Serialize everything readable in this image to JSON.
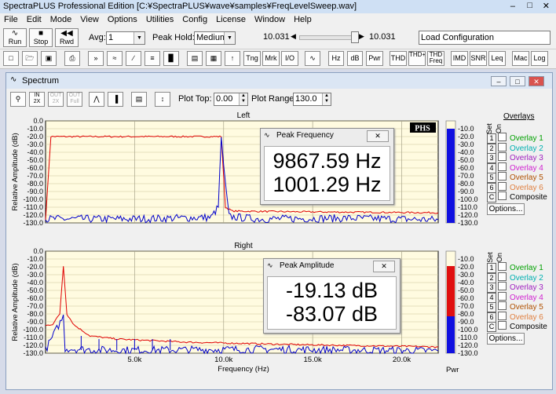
{
  "app": {
    "title": "SpectraPLUS Professional Edition [C:¥SpectraPLUS¥wave¥samples¥FreqLevelSweep.wav]"
  },
  "menu": [
    "File",
    "Edit",
    "Mode",
    "View",
    "Options",
    "Utilities",
    "Config",
    "License",
    "Window",
    "Help"
  ],
  "toolbar": {
    "run_label": "Run",
    "stop_label": "Stop",
    "rwd_label": "Rwd",
    "avg_label": "Avg:",
    "avg_value": "1",
    "peak_hold_label": "Peak Hold:",
    "peak_hold_value": "Medium",
    "slider_left_value": "10.031",
    "slider_right_value": "10.031",
    "load_config": "Load Configuration"
  },
  "toolbar2": [
    "Tng",
    "Mrk",
    "I/O",
    "Hz",
    "dB",
    "Pwr",
    "THD",
    "THD+N",
    "THD Freq",
    "IMD",
    "SNR",
    "Leq",
    "Mac",
    "Log"
  ],
  "window": {
    "title": "Spectrum",
    "plot_top_label": "Plot Top:",
    "plot_top_value": "0.00",
    "plot_range_label": "Plot Range:",
    "plot_range_value": "130.0"
  },
  "plots": {
    "left_title": "Left",
    "right_title": "Right",
    "ylabel": "Relative Amplitude (dB)",
    "xlabel": "Frequency (Hz)",
    "y_ticks": [
      "0.0",
      "-10.0",
      "-20.0",
      "-30.0",
      "-40.0",
      "-50.0",
      "-60.0",
      "-70.0",
      "-80.0",
      "-90.0",
      "-100.0",
      "-110.0",
      "-120.0",
      "-130.0"
    ],
    "x_ticks": [
      "5.0k",
      "10.0k",
      "15.0k",
      "20.0k"
    ],
    "phs_label": "PHS",
    "meter_label": "Pwr"
  },
  "popups": {
    "freq_title": "Peak Frequency",
    "freq_line1": "9867.59 Hz",
    "freq_line2": "1001.29 Hz",
    "amp_title": "Peak Amplitude",
    "amp_line1": "-19.13 dB",
    "amp_line2": "-83.07 dB"
  },
  "overlays": {
    "title": "Overlays",
    "set_label": "Set",
    "on_label": "On",
    "items": [
      {
        "num": "1",
        "label": "Overlay 1",
        "color": "#00a000"
      },
      {
        "num": "2",
        "label": "Overlay 2",
        "color": "#00b0b0"
      },
      {
        "num": "3",
        "label": "Overlay 3",
        "color": "#a020c0"
      },
      {
        "num": "4",
        "label": "Overlay 4",
        "color": "#d020d0"
      },
      {
        "num": "5",
        "label": "Overlay 5",
        "color": "#b05000"
      },
      {
        "num": "6",
        "label": "Overlay 6",
        "color": "#e08040"
      }
    ],
    "composite_num": "C",
    "composite_label": "Composite",
    "options_label": "Options..."
  },
  "chart_data": [
    {
      "type": "line",
      "title": "Left",
      "xlabel": "Frequency (Hz)",
      "ylabel": "Relative Amplitude (dB)",
      "xlim": [
        0,
        22050
      ],
      "ylim": [
        -130,
        0
      ],
      "series": [
        {
          "color": "#e00000",
          "x": [
            0,
            300,
            700,
            9300,
            9700,
            9868,
            10100,
            10500,
            15000,
            22050
          ],
          "values": [
            -126,
            -20,
            -20,
            -20,
            -20,
            -20,
            -110,
            -115,
            -116,
            -117
          ]
        },
        {
          "color": "#0000cc",
          "x": [
            0,
            5000,
            9300,
            9700,
            9868,
            10000,
            10300,
            12000,
            17000,
            22050
          ],
          "values": [
            -125,
            -125,
            -123,
            -110,
            -20,
            -60,
            -122,
            -125,
            -124,
            -126
          ]
        }
      ],
      "meter": {
        "blue_from": -130,
        "blue_to": -10
      }
    },
    {
      "type": "line",
      "title": "Right",
      "xlabel": "Frequency (Hz)",
      "ylabel": "Relative Amplitude (dB)",
      "xlim": [
        0,
        22050
      ],
      "ylim": [
        -130,
        0
      ],
      "series": [
        {
          "color": "#e00000",
          "x": [
            0,
            400,
            800,
            1001,
            1200,
            1600,
            2500,
            4000,
            8000,
            14000,
            22050
          ],
          "values": [
            -95,
            -93,
            -80,
            -19,
            -80,
            -94,
            -108,
            -112,
            -116,
            -119,
            -122
          ]
        },
        {
          "color": "#0000cc",
          "x": [
            0,
            1001,
            1100,
            2000,
            3000,
            6000,
            12000,
            22050
          ],
          "values": [
            -126,
            -83,
            -124,
            -125,
            -126,
            -126,
            -125,
            -127
          ]
        }
      ],
      "meter": {
        "blue_from": -130,
        "blue_to": -83,
        "red_from": -83,
        "red_to": -19
      }
    }
  ]
}
